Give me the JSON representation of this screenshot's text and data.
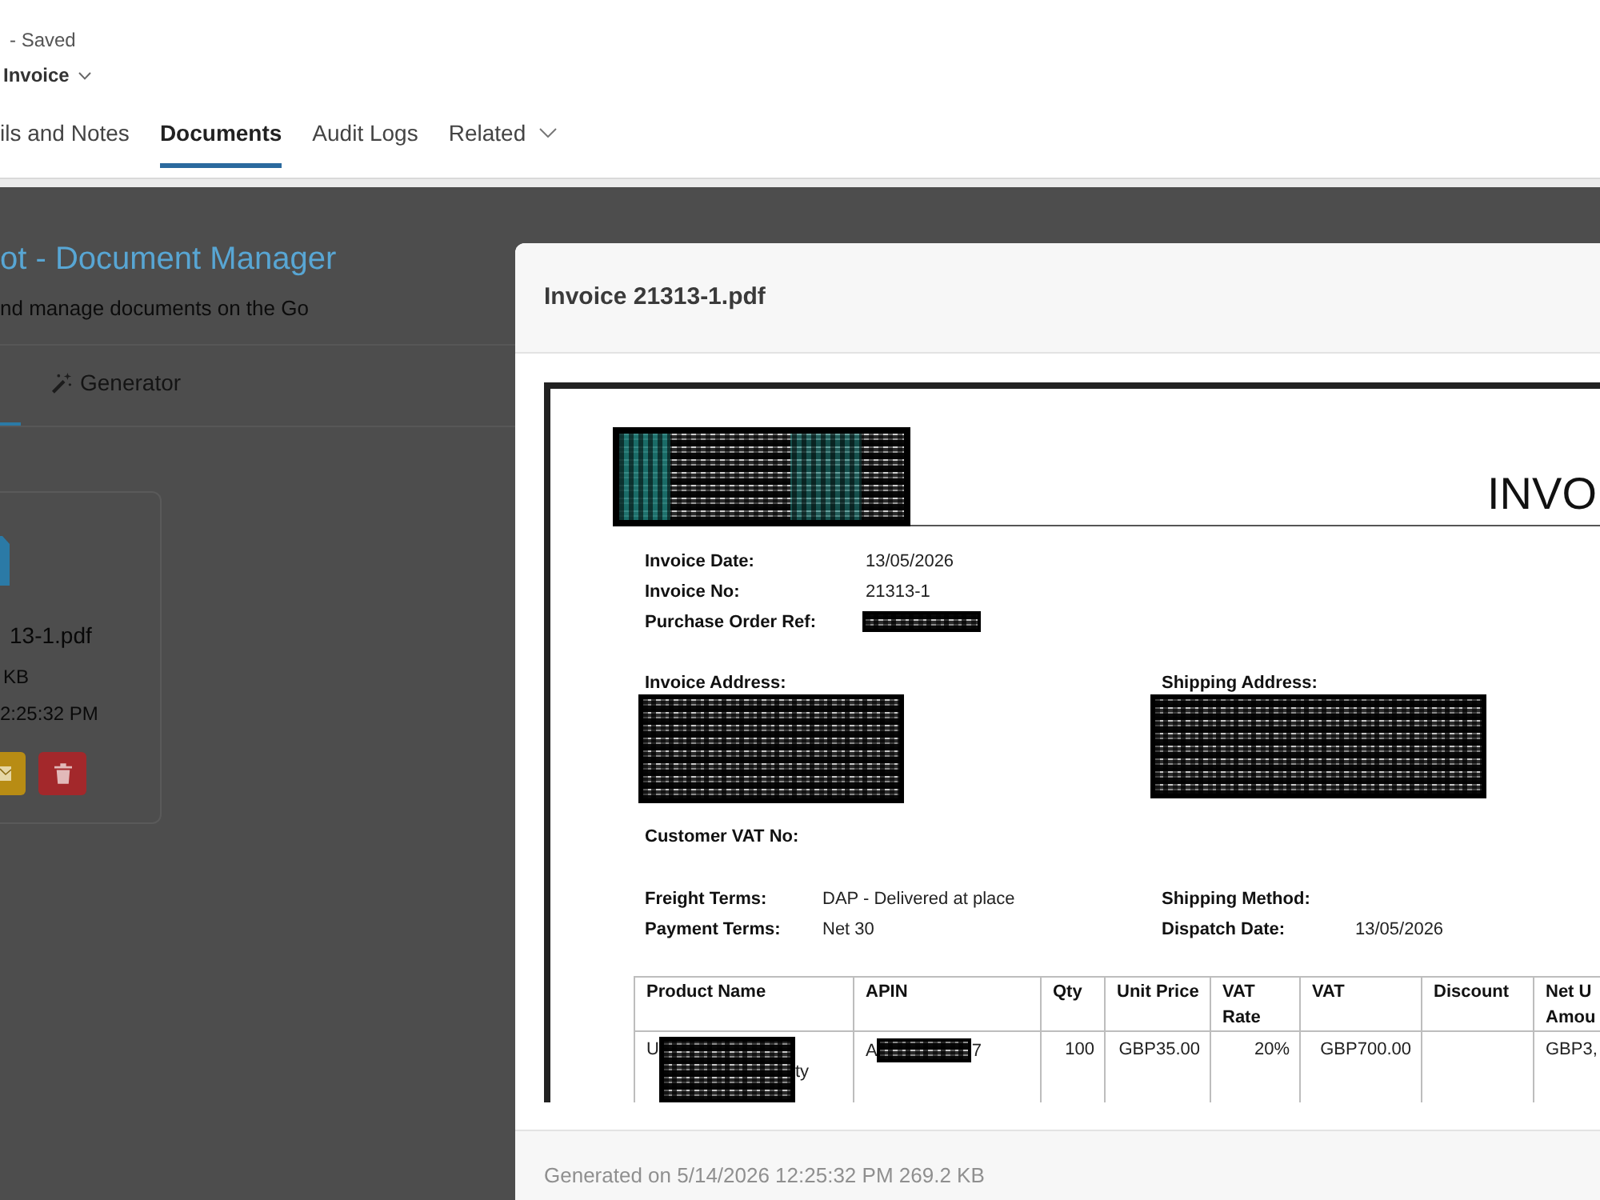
{
  "record_header": {
    "status": "- Saved",
    "form_selector": "Invoice"
  },
  "tabs": [
    {
      "label": "ils and Notes",
      "selected": false,
      "dropdown": false
    },
    {
      "label": "Documents",
      "selected": true,
      "dropdown": false
    },
    {
      "label": "Audit Logs",
      "selected": false,
      "dropdown": false
    },
    {
      "label": "Related",
      "selected": false,
      "dropdown": true
    }
  ],
  "document_manager": {
    "title": "ot - Document Manager",
    "subtitle": "nd manage documents on the Go",
    "tabs": [
      {
        "selected": true
      },
      {
        "label": "Generator",
        "selected": false
      }
    ],
    "file_card": {
      "name": "13-1.pdf",
      "size": "KB",
      "time": "2:25:32 PM",
      "actions": [
        {
          "kind": "email"
        },
        {
          "kind": "delete"
        }
      ]
    }
  },
  "preview_modal": {
    "title": "Invoice 21313-1.pdf",
    "document": {
      "heading": "INVO",
      "details": [
        {
          "label": "Invoice Date:",
          "value": "13/05/2026",
          "redacted": false
        },
        {
          "label": "Invoice No:",
          "value": "21313-1",
          "redacted": false
        },
        {
          "label": "Purchase Order Ref:",
          "redacted": true
        }
      ],
      "addresses": [
        {
          "label": "Invoice Address:",
          "redacted": true
        },
        {
          "label": "Shipping Address:",
          "redacted": true
        }
      ],
      "customer_vat_label": "Customer VAT No:",
      "terms": [
        {
          "label": "Freight Terms:",
          "value": "DAP - Delivered at place"
        },
        {
          "label": "Shipping Method:"
        },
        {
          "label": "Payment Terms:",
          "value": "Net 30"
        },
        {
          "label": "Dispatch Date:",
          "value": "13/05/2026"
        }
      ],
      "table": {
        "columns": [
          "Product Name",
          "APIN",
          "Qty",
          "Unit Price",
          "VAT Rate",
          "VAT",
          "Discount",
          "Net U\nAmou"
        ],
        "rows": [
          [
            {
              "prefix": "U",
              "suffix": "ty",
              "redacted": true
            },
            {
              "prefix": "A",
              "suffix": "7",
              "redacted": true
            },
            {
              "text": "100",
              "redacted": false
            },
            {
              "text": "GBP35.00",
              "redacted": false
            },
            {
              "text": "20%",
              "redacted": false
            },
            {
              "text": "GBP700.00",
              "redacted": false
            },
            {
              "redacted": false
            },
            {
              "text": "GBP3,",
              "redacted": false
            }
          ]
        ]
      }
    },
    "footer": "Generated on 5/14/2026 12:25:32 PM 269.2 KB"
  }
}
